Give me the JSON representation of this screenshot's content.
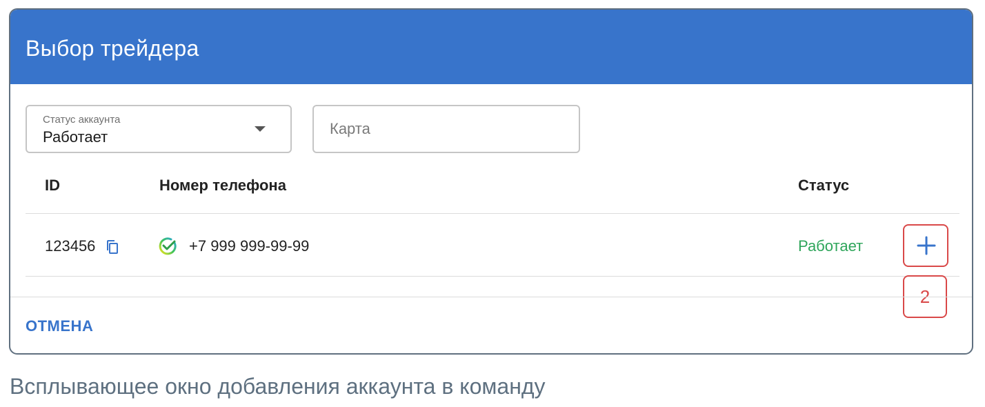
{
  "dialog": {
    "title": "Выбор трейдера",
    "header_color": "#3874cb"
  },
  "filters": {
    "status_select": {
      "label": "Статус аккаунта",
      "value": "Работает"
    },
    "card_input": {
      "placeholder": "Карта",
      "value": ""
    }
  },
  "table": {
    "columns": [
      "ID",
      "Номер телефона",
      "Статус"
    ],
    "rows": [
      {
        "id": "123456",
        "phone": "+7 999 999-99-99",
        "status": "Работает",
        "status_color": "#2ea55a",
        "bank_icon": "sber-check-icon"
      }
    ]
  },
  "annotation": {
    "badge": "2"
  },
  "footer": {
    "cancel_label": "ОТМЕНА"
  },
  "caption": "Всплывающее окно добавления аккаунта в команду"
}
